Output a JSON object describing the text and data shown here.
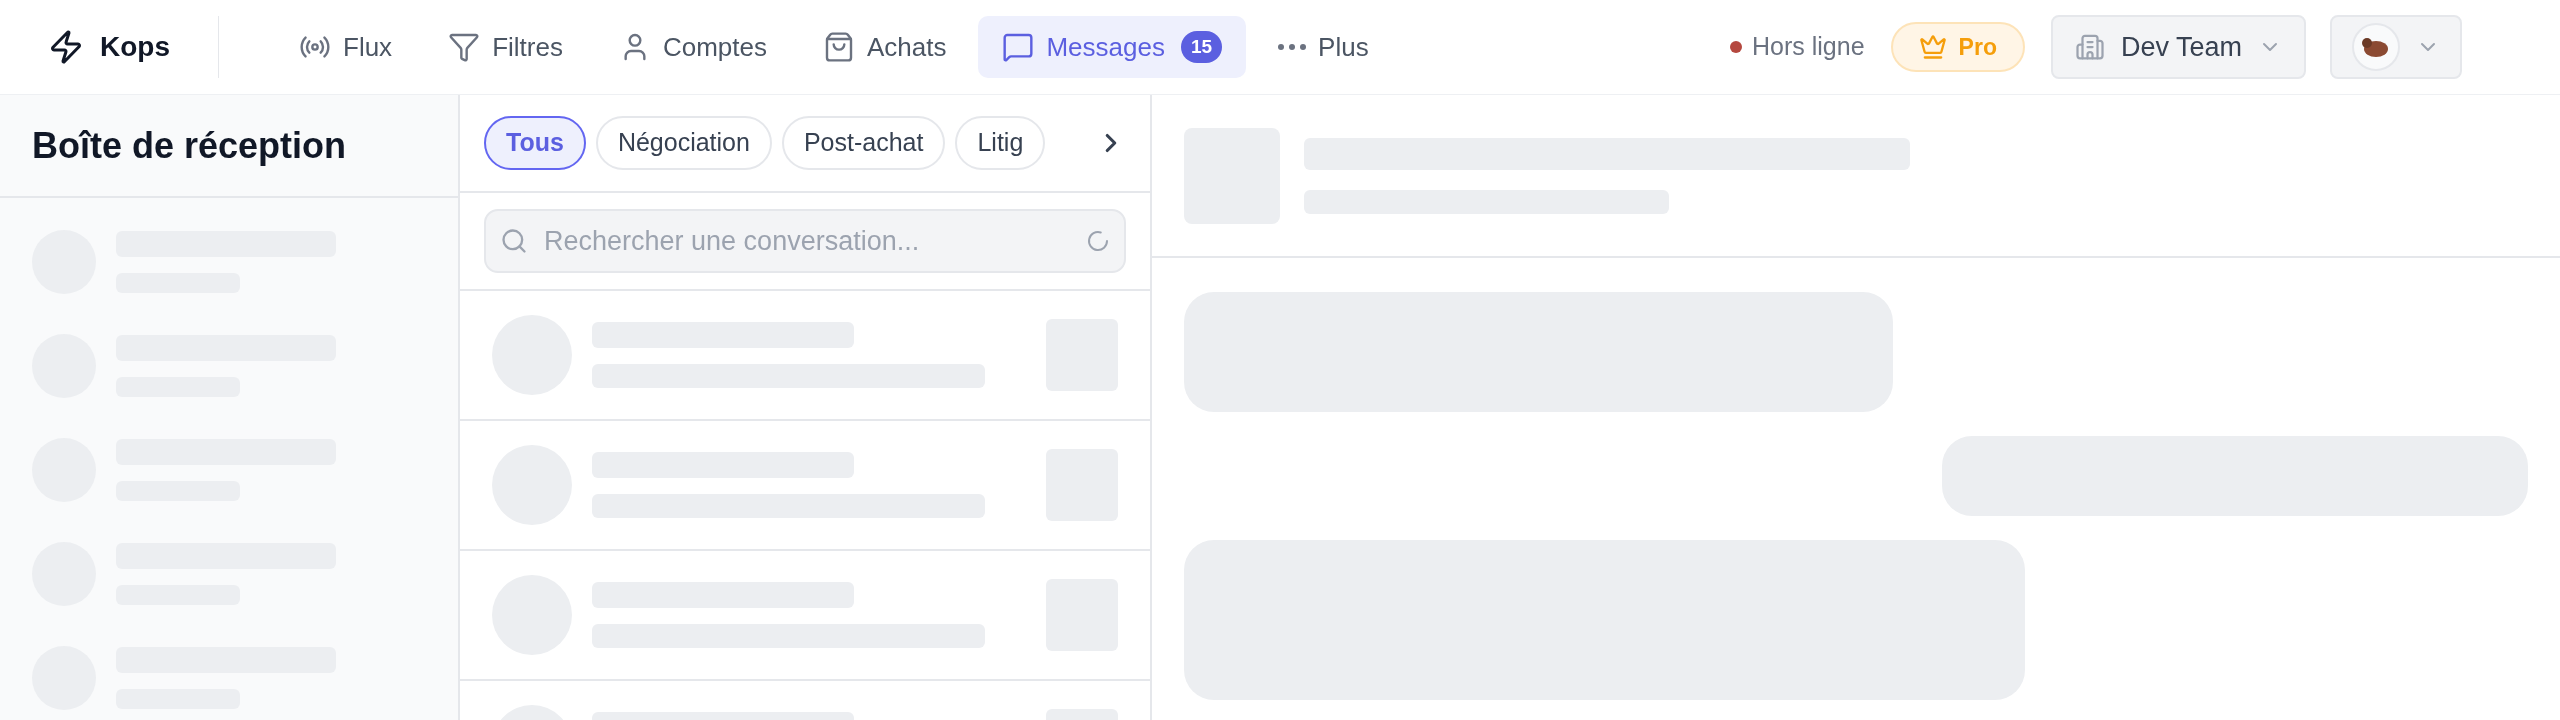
{
  "brand": {
    "name": "Kops"
  },
  "nav": [
    {
      "label": "Flux",
      "selected": false
    },
    {
      "label": "Filtres",
      "selected": false
    },
    {
      "label": "Comptes",
      "selected": false
    },
    {
      "label": "Achats",
      "selected": false
    },
    {
      "label": "Messages",
      "selected": true,
      "badge": "15"
    },
    {
      "label": "Plus",
      "selected": false
    }
  ],
  "status": {
    "label": "Hors ligne",
    "color": "#b5483f"
  },
  "plan": {
    "label": "Pro"
  },
  "team": {
    "label": "Dev Team"
  },
  "inbox": {
    "title": "Boîte de réception"
  },
  "chips": [
    {
      "label": "Tous",
      "selected": true
    },
    {
      "label": "Négociation",
      "selected": false
    },
    {
      "label": "Post-achat",
      "selected": false
    },
    {
      "label": "Litig",
      "selected": false
    }
  ],
  "search": {
    "placeholder": "Rechercher une conversation..."
  }
}
